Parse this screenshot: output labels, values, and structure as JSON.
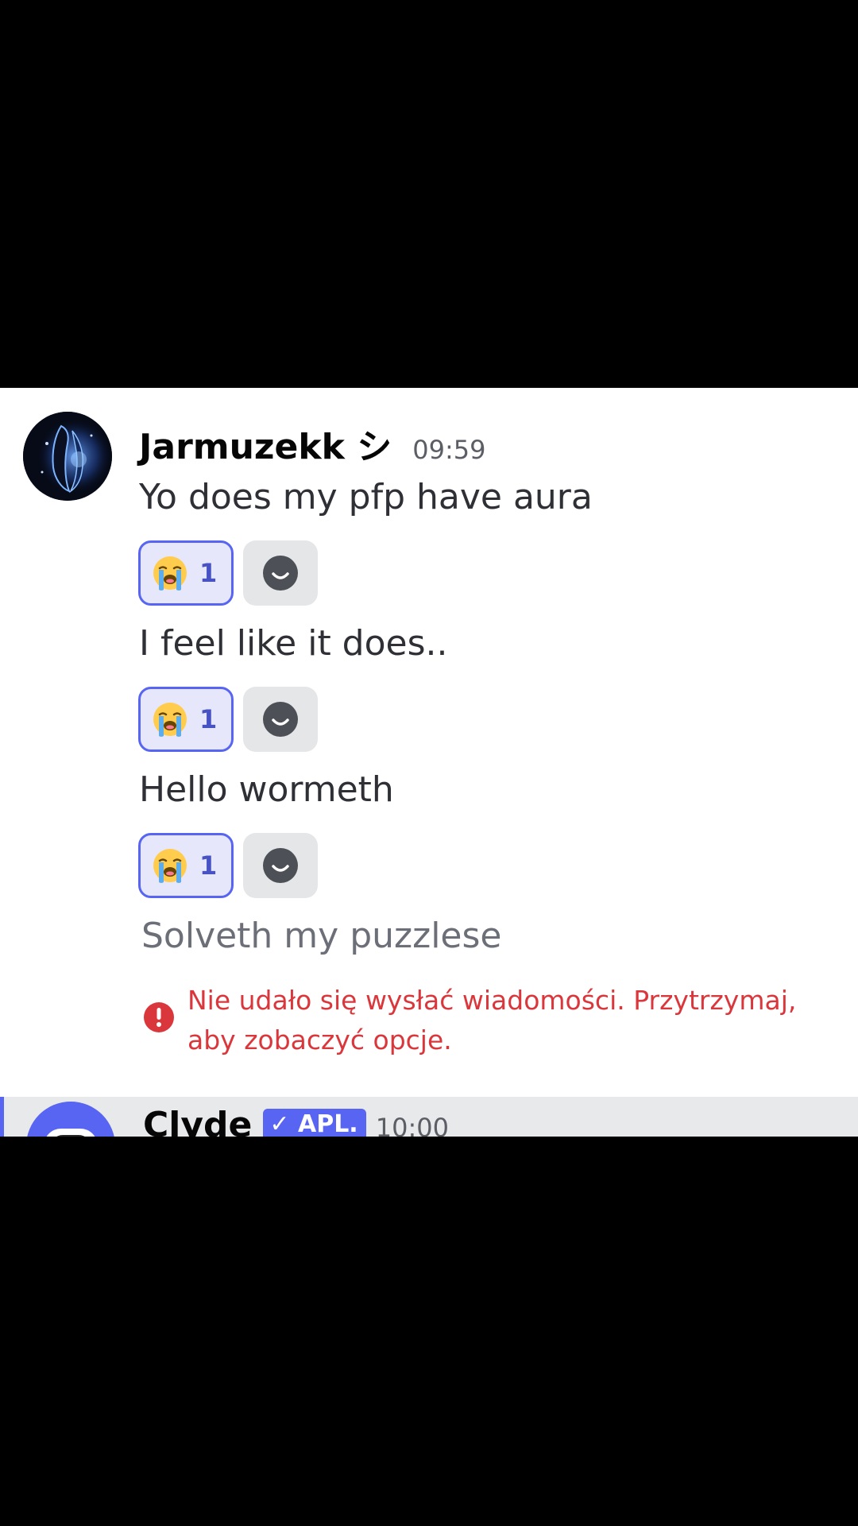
{
  "colors": {
    "background": "#ffffff",
    "letterbox": "#000000",
    "accent": "#5865f2",
    "error": "#da373c",
    "reaction_bg": "#e7e7fb",
    "add_reaction_bg": "#e5e6e8",
    "highlight_row": "#e8e9eb"
  },
  "message_group": {
    "author": "Jarmuzekk シ",
    "timestamp": "09:59",
    "avatar_icon": "avatar-image",
    "messages": [
      {
        "text": "Yo does my pfp have aura",
        "reaction": {
          "emoji": "loudly-crying-face",
          "count": "1"
        }
      },
      {
        "text": "I feel like it does..",
        "reaction": {
          "emoji": "loudly-crying-face",
          "count": "1"
        }
      },
      {
        "text": "Hello wormeth",
        "reaction": {
          "emoji": "loudly-crying-face",
          "count": "1"
        }
      },
      {
        "text": "Solveth my puzzlese"
      }
    ],
    "add_reaction_icon": "smile-icon",
    "error": {
      "icon": "error-icon",
      "text": "Nie udało się wysłać wiadomości. Przytrzymaj, aby zobaczyć opcje."
    }
  },
  "next_message": {
    "author": "Clyde",
    "badge": "✓ APL.",
    "timestamp": "10:00"
  }
}
